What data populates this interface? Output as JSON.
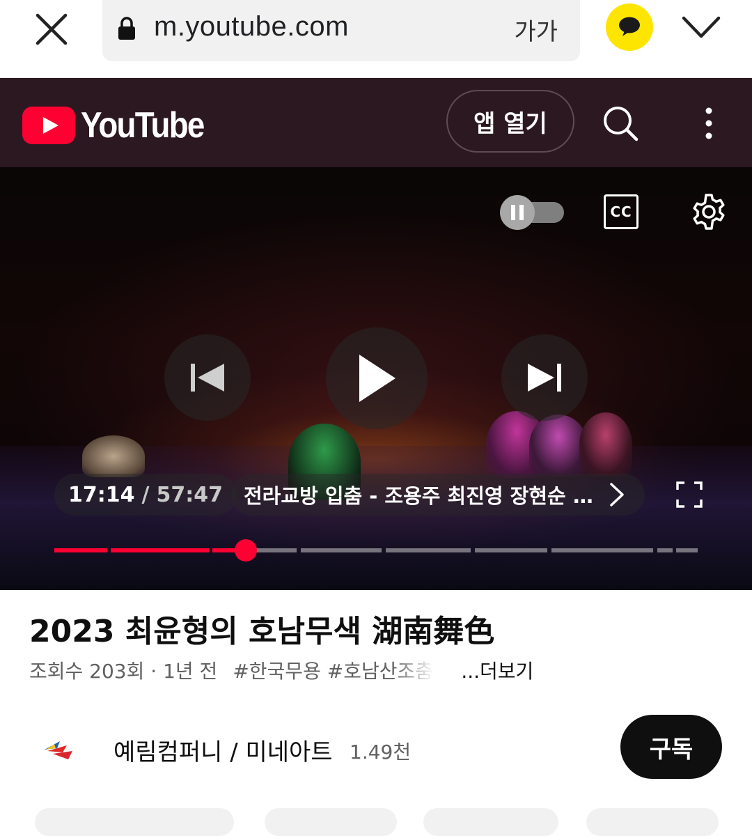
{
  "browser": {
    "url": "m.youtube.com",
    "text_size_label": "가가",
    "accent_kakao": "#fee500"
  },
  "header": {
    "logo_text": "YouTube",
    "open_app_label": "앱 열기",
    "brand_color": "#ff0033",
    "bg_color": "#2c1820"
  },
  "player": {
    "current_time": "17:14",
    "separator": "/",
    "total_time": "57:47",
    "chapter_title": "전라교방 입춤 - 조용주 최진영 장현순 천...",
    "cc_label": "CC",
    "progress_fraction": 0.298,
    "icons": [
      "close-icon",
      "lock-icon",
      "chat-bubble-icon",
      "chevron-down-icon",
      "search-icon",
      "more-vert-icon",
      "pause-icon",
      "cc-icon",
      "gear-icon",
      "skip-previous-icon",
      "play-icon",
      "skip-next-icon",
      "chevron-right-icon",
      "fullscreen-icon"
    ]
  },
  "video": {
    "title": "2023 최윤형의 호남무색 湖南舞色",
    "views": "조회수 203회 · 1년 전",
    "tags": "#한국무용 #호남산조춤",
    "more_label": "...더보기"
  },
  "channel": {
    "name": "예림컴퍼니 / 미네아트",
    "subscribers": "1.49천",
    "subscribe_label": "구독"
  }
}
